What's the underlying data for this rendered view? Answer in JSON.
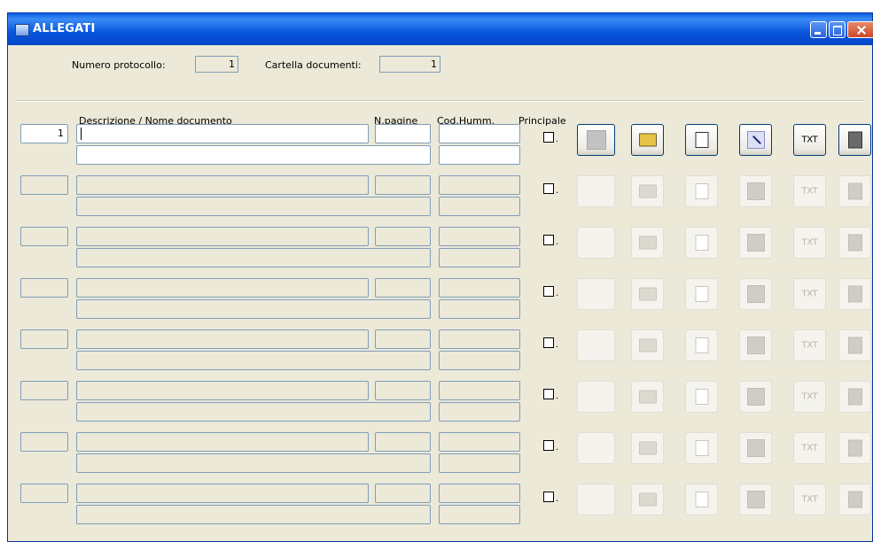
{
  "window": {
    "title": "ALLEGATI"
  },
  "header": {
    "protocol_label": "Numero protocollo:",
    "protocol_value": "1",
    "folder_label": "Cartella documenti:",
    "folder_value": "1"
  },
  "columns": {
    "description": "Descrizione / Nome documento",
    "pages": "N.pagine",
    "code": "Cod.Humm.",
    "main": "Principale"
  },
  "rows": [
    {
      "number": "1",
      "active": true
    },
    {
      "number": "",
      "active": false
    },
    {
      "number": "",
      "active": false
    },
    {
      "number": "",
      "active": false
    },
    {
      "number": "",
      "active": false
    },
    {
      "number": "",
      "active": false
    },
    {
      "number": "",
      "active": false
    },
    {
      "number": "",
      "active": false
    }
  ],
  "checkbox_suffix": ".",
  "row_buttons": [
    {
      "name": "preview",
      "icon": "blank-gray-icon"
    },
    {
      "name": "browse-folder",
      "icon": "open-folder-icon"
    },
    {
      "name": "open-document",
      "icon": "document-icon"
    },
    {
      "name": "sign",
      "icon": "pen-icon"
    },
    {
      "name": "text",
      "icon": "txt-icon",
      "label": "TXT"
    },
    {
      "name": "paste",
      "icon": "clipboard-icon"
    }
  ]
}
